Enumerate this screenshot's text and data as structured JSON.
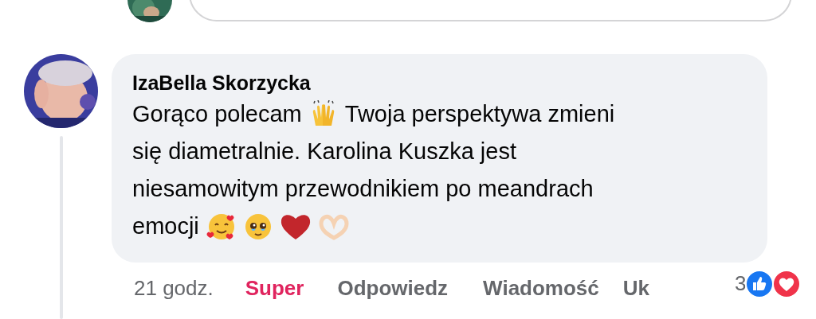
{
  "comment": {
    "author": "IzaBella Skorzycka",
    "lines": [
      [
        {
          "kind": "text",
          "text": "Gorąco polecam"
        },
        {
          "kind": "emoji"
        },
        {
          "kind": "text",
          "text": "Twoja perspektywa zmieni"
        }
      ],
      [
        {
          "kind": "text",
          "text": "się diametralnie. Karolina Kuszka jest"
        }
      ],
      [
        {
          "kind": "text",
          "text": "niesamowitym przewodnikiem po meandrach"
        }
      ],
      [
        {
          "kind": "text",
          "text": "emocji"
        },
        {
          "kind": "emoji"
        },
        {
          "kind": "emoji"
        },
        {
          "kind": "emoji"
        },
        {
          "kind": "emoji"
        }
      ]
    ],
    "time": "21 godz.",
    "actions": [
      {
        "label": "Super",
        "selected": true
      },
      {
        "label": "Odpowiedz",
        "selected": false
      },
      {
        "label": "Wiadomość",
        "selected": false
      },
      {
        "label": "Uk",
        "selected": false
      }
    ],
    "reaction_count": "3"
  }
}
